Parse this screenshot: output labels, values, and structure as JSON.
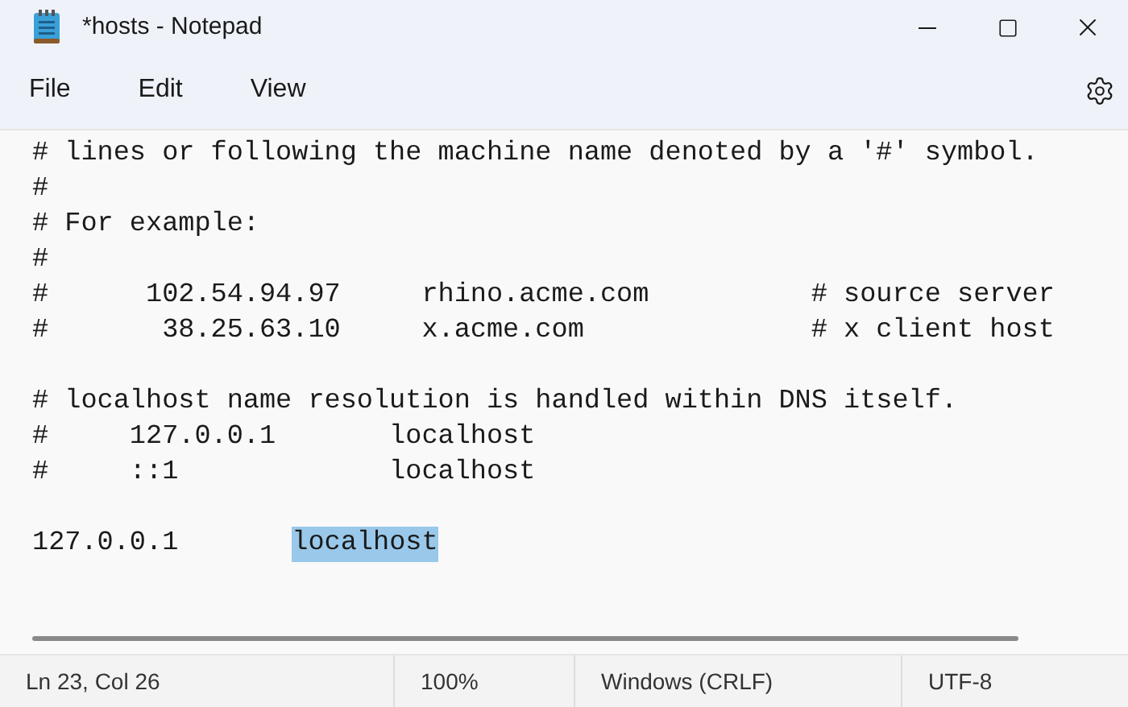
{
  "window": {
    "title": "*hosts - Notepad"
  },
  "menu": [
    "File",
    "Edit",
    "View"
  ],
  "editor": {
    "lines": [
      {
        "kind": "text",
        "text": "# lines or following the machine name denoted by a '#' symbol."
      },
      {
        "kind": "text",
        "text": "#"
      },
      {
        "kind": "text",
        "text": "# For example:"
      },
      {
        "kind": "text",
        "text": "#"
      },
      {
        "kind": "text",
        "text": "#      102.54.94.97     rhino.acme.com          # source server"
      },
      {
        "kind": "text",
        "text": "#       38.25.63.10     x.acme.com              # x client host"
      },
      {
        "kind": "blank"
      },
      {
        "kind": "text",
        "text": "# localhost name resolution is handled within DNS itself."
      },
      {
        "kind": "text",
        "text": "#     127.0.0.1       localhost"
      },
      {
        "kind": "text",
        "text": "#     ::1             localhost"
      },
      {
        "kind": "blank"
      },
      {
        "kind": "text",
        "text": "127.0.0.1       ",
        "selection": "localhost"
      }
    ]
  },
  "status_bar": [
    "Ln 23, Col 26",
    "100%",
    "Windows (CRLF)",
    "UTF-8"
  ]
}
